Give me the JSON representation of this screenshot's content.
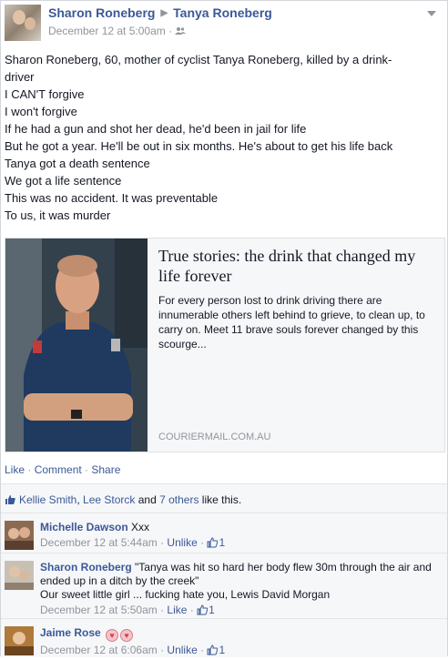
{
  "post": {
    "author": "Sharon Roneberg",
    "target": "Tanya Roneberg",
    "timestamp": "December 12 at 5:00am",
    "audience_icon": "friends-icon",
    "lines": [
      "Sharon Roneberg, 60, mother of cyclist Tanya Roneberg, killed by a drink-",
      "driver",
      "I CAN'T forgive",
      "I won't forgive",
      "If he had a gun and shot her dead, he'd been in jail for life",
      "But he got a year. He'll be out in six months. He's about to get his life back",
      "Tanya got a death sentence",
      "We got a life sentence",
      "This was no accident. It was preventable",
      "To us, it was murder"
    ]
  },
  "attachment": {
    "title": "True stories: the drink that changed my life forever",
    "description": "For every person lost to drink driving there are innumerable others left behind to grieve, to clean up, to carry on. Meet 11 brave souls forever changed by this scourge...",
    "source": "COURIERMAIL.COM.AU"
  },
  "actions": {
    "like": "Like",
    "comment": "Comment",
    "share": "Share",
    "sep": " · "
  },
  "likes": {
    "person1": "Kellie Smith",
    "comma": ", ",
    "person2": "Lee Storck",
    "and": " and ",
    "others": "7 others",
    "suffix": " like this."
  },
  "comments": [
    {
      "name": "Michelle Dawson",
      "text": "Xxx",
      "time": "December 12 at 5:44am",
      "action": "Unlike",
      "likes": "1"
    },
    {
      "name": "Sharon Roneberg",
      "text": "\"Tanya was hit so hard her body flew 30m through the air and ended up in a ditch by the creek\"",
      "text2": "Our sweet little girl ... fucking hate you, Lewis David Morgan",
      "time": "December 12 at 5:50am",
      "action": "Like",
      "likes": "1"
    },
    {
      "name": "Jaime Rose",
      "text": "",
      "time": "December 12 at 6:06am",
      "action": "Unlike",
      "likes": "1"
    }
  ],
  "dot": " · ",
  "colors": {
    "link": "#3b5998",
    "meta": "#90949c",
    "panel": "#f6f7f9"
  }
}
